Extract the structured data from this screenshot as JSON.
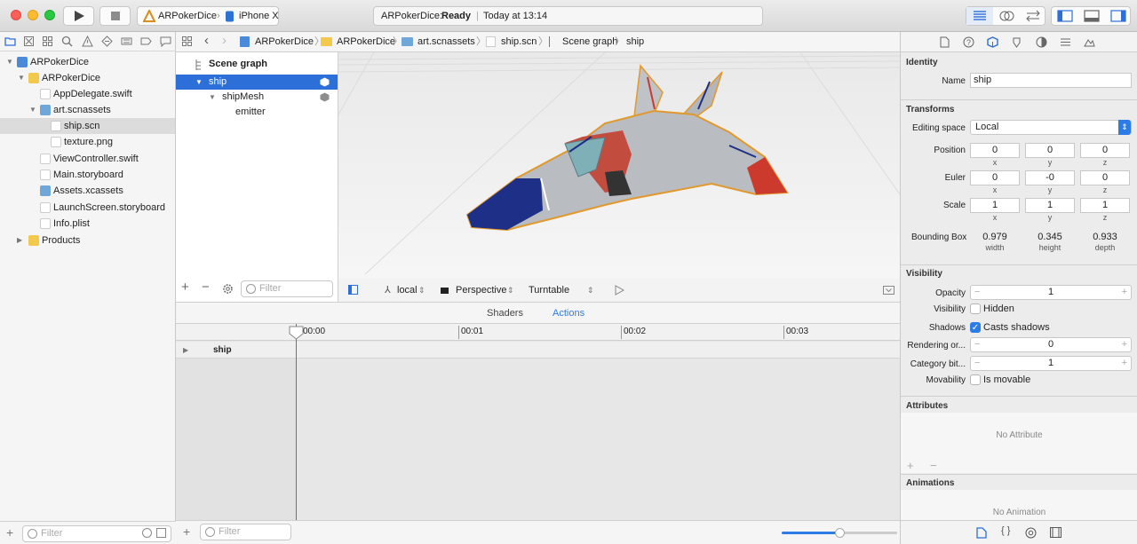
{
  "toolbar": {
    "scheme_app": "ARPokerDice",
    "scheme_device": "iPhone X",
    "status_app": "ARPokerDice:",
    "status_state": "Ready",
    "status_time": "Today at 13:14"
  },
  "navigator": {
    "items": [
      {
        "label": "ARPokerDice"
      },
      {
        "label": "ARPokerDice"
      },
      {
        "label": "AppDelegate.swift"
      },
      {
        "label": "art.scnassets"
      },
      {
        "label": "ship.scn"
      },
      {
        "label": "texture.png"
      },
      {
        "label": "ViewController.swift"
      },
      {
        "label": "Main.storyboard"
      },
      {
        "label": "Assets.xcassets"
      },
      {
        "label": "LaunchScreen.storyboard"
      },
      {
        "label": "Info.plist"
      },
      {
        "label": "Products"
      }
    ],
    "filter_placeholder": "Filter"
  },
  "jumpbar": {
    "crumbs": [
      "ARPokerDice",
      "ARPokerDice",
      "art.scnassets",
      "ship.scn",
      "Scene graph",
      "ship"
    ]
  },
  "scene_graph": {
    "header": "Scene graph",
    "nodes": [
      "ship",
      "shipMesh",
      "emitter"
    ],
    "filter_placeholder": "Filter"
  },
  "viewport_bar": {
    "space": "local",
    "camera": "Perspective",
    "mode": "Turntable"
  },
  "bottom_tabs": {
    "shaders": "Shaders",
    "actions": "Actions"
  },
  "timeline": {
    "ticks": [
      "00:00",
      "00:01",
      "00:02",
      "00:03"
    ],
    "track": "ship",
    "filter_placeholder": "Filter",
    "zoom_level": 0.5
  },
  "inspector": {
    "identity": {
      "heading": "Identity",
      "name_label": "Name",
      "name_value": "ship"
    },
    "transforms": {
      "heading": "Transforms",
      "editing_space_label": "Editing space",
      "editing_space_value": "Local",
      "position_label": "Position",
      "position": [
        "0",
        "0",
        "0"
      ],
      "euler_label": "Euler",
      "euler": [
        "0",
        "-0",
        "0"
      ],
      "scale_label": "Scale",
      "scale": [
        "1",
        "1",
        "1"
      ],
      "axes": [
        "x",
        "y",
        "z"
      ],
      "bbox_label": "Bounding Box",
      "bbox_values": [
        "0.979",
        "0.345",
        "0.933"
      ],
      "bbox_caps": [
        "width",
        "height",
        "depth"
      ]
    },
    "visibility": {
      "heading": "Visibility",
      "opacity_label": "Opacity",
      "opacity_value": "1",
      "visibility_label": "Visibility",
      "hidden_label": "Hidden",
      "shadows_label": "Shadows",
      "casts_label": "Casts shadows",
      "rendering_label": "Rendering or...",
      "rendering_value": "0",
      "category_label": "Category bit...",
      "category_value": "1",
      "movability_label": "Movability",
      "movable_label": "Is movable"
    },
    "attributes": {
      "heading": "Attributes",
      "empty": "No Attribute"
    },
    "animations": {
      "heading": "Animations",
      "empty": "No Animation"
    }
  },
  "colors": {
    "accent": "#2d6fd8",
    "playhead": "#d9473b",
    "ship_blue": "#1d2f86",
    "ship_red": "#cc3a2e",
    "ship_body": "#b9bcc1"
  }
}
